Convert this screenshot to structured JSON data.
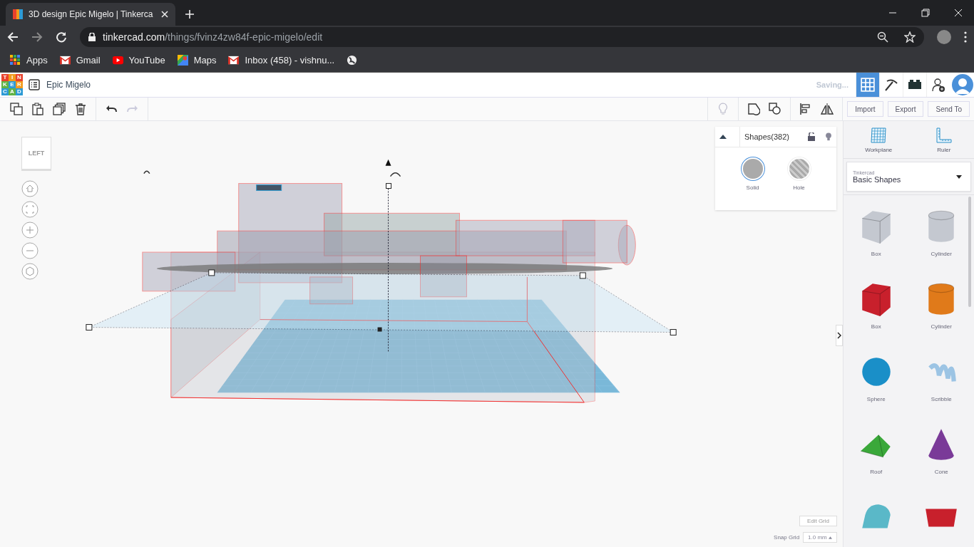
{
  "browser": {
    "tabs": [
      {
        "title": "3D design Epic Migelo | Tinkerca",
        "selected": true
      }
    ],
    "url_host": "tinkercad.com",
    "url_path": "/things/fvinz4zw84f-epic-migelo/edit",
    "bookmarks": [
      {
        "kind": "apps",
        "label": "Apps"
      },
      {
        "kind": "mail",
        "label": "Gmail"
      },
      {
        "kind": "video",
        "label": "YouTube"
      },
      {
        "kind": "map",
        "label": "Maps"
      },
      {
        "kind": "mail",
        "label": "Inbox (458) - vishnu..."
      },
      {
        "kind": "globe"
      }
    ]
  },
  "app": {
    "logo": [
      {
        "letter": "T",
        "color": "#e8412c"
      },
      {
        "letter": "I",
        "color": "#f29b1d"
      },
      {
        "letter": "N",
        "color": "#e8412c"
      },
      {
        "letter": "K",
        "color": "#61b346"
      },
      {
        "letter": "E",
        "color": "#2d9ad5"
      },
      {
        "letter": "R",
        "color": "#f29b1d"
      },
      {
        "letter": "C",
        "color": "#2d9ad5"
      },
      {
        "letter": "A",
        "color": "#61b346"
      },
      {
        "letter": "D",
        "color": "#2d9ad5"
      }
    ],
    "design_name": "Epic Migelo",
    "status": "Saving...",
    "views": [
      {
        "kind": "grid",
        "selected": true
      },
      {
        "kind": "pickaxe",
        "selected": false
      },
      {
        "kind": "bricks",
        "selected": false
      }
    ],
    "actions": [
      "Import",
      "Export",
      "Send To"
    ]
  },
  "view_cube": "LEFT",
  "shapes_panel": {
    "title": "Shapes(382)",
    "modes": [
      {
        "label": "Solid",
        "selected": true
      },
      {
        "label": "Hole",
        "selected": false
      }
    ]
  },
  "sidebar": {
    "tools": [
      {
        "kind": "workplane",
        "label": "Workplane"
      },
      {
        "kind": "ruler",
        "label": "Ruler"
      }
    ],
    "library_caption": "Tinkercad",
    "library": "Basic Shapes",
    "shapes": [
      {
        "kind": "box",
        "label": "Box",
        "color": "#c4c8d0"
      },
      {
        "kind": "cylinder",
        "label": "Cylinder",
        "color": "#c4c8d0"
      },
      {
        "kind": "box",
        "label": "Box",
        "color": "#c8202c"
      },
      {
        "kind": "cylinder",
        "label": "Cylinder",
        "color": "#e07a1a"
      },
      {
        "kind": "sphere",
        "label": "Sphere",
        "color": "#1a8fc8"
      },
      {
        "kind": "scribble",
        "label": "Scribble",
        "color": "#9cc4e4"
      },
      {
        "kind": "roof",
        "label": "Roof",
        "color": "#3aa83a"
      },
      {
        "kind": "cone",
        "label": "Cone",
        "color": "#7a3a98"
      },
      {
        "kind": "round-roof",
        "color": "#5ab8c8"
      },
      {
        "kind": "text",
        "color": "#c8202c"
      }
    ]
  },
  "grid": {
    "edit": "Edit Grid",
    "snap_label": "Snap Grid",
    "snap_value": "1.0 mm"
  }
}
